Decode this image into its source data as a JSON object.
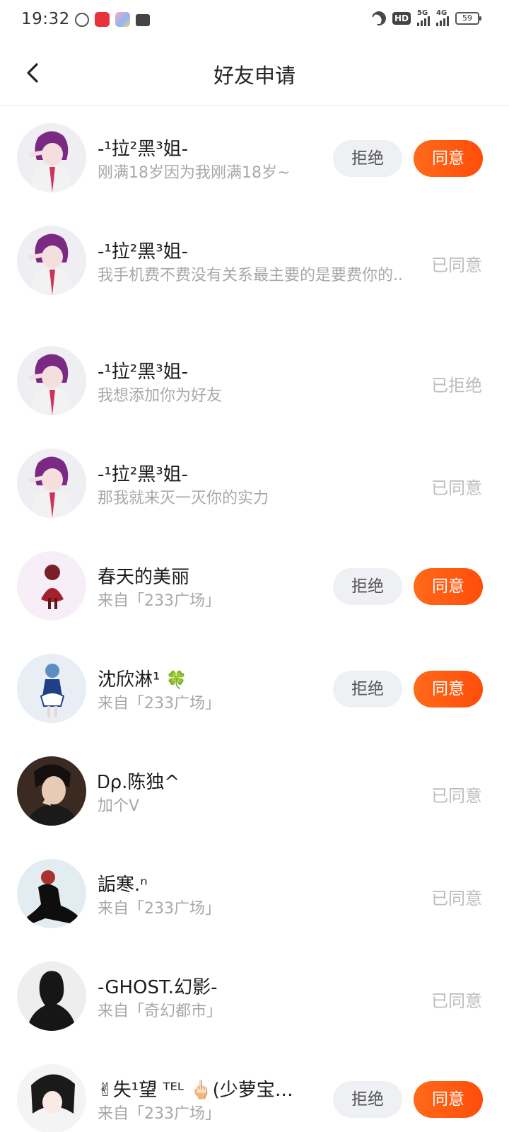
{
  "status_bar": {
    "time": "19:32",
    "hd_label": "HD",
    "net1": "5G",
    "net2": "4G",
    "battery": "59"
  },
  "header": {
    "title": "好友申请"
  },
  "buttons": {
    "reject": "拒绝",
    "accept": "同意"
  },
  "requests": [
    {
      "name": "-¹拉²黑³姐-",
      "message": "刚满18岁因为我刚满18岁~",
      "state": "pending",
      "avatar": "anime-girl-purple-hair-avatar"
    },
    {
      "name": "-¹拉²黑³姐-",
      "message": "我手机费不费没有关系最主要的是要费你的..",
      "state": "accepted",
      "status_text": "已同意",
      "avatar": "anime-girl-purple-hair-avatar"
    },
    {
      "name": "-¹拉²黑³姐-",
      "message": "我想添加你为好友",
      "state": "rejected",
      "status_text": "已拒绝",
      "avatar": "anime-girl-purple-hair-avatar"
    },
    {
      "name": "-¹拉²黑³姐-",
      "message": "那我就来灭一灭你的实力",
      "state": "accepted",
      "status_text": "已同意",
      "avatar": "anime-girl-purple-hair-avatar"
    },
    {
      "name": "春天的美丽",
      "message": "来自「233广场」",
      "state": "pending",
      "avatar": "red-dress-doll-avatar"
    },
    {
      "name": "沈欣淋¹",
      "name_emoji": "🍀",
      "message": "来自「233广场」",
      "state": "pending",
      "avatar": "blue-hair-maid-avatar"
    },
    {
      "name": "Ꭰρ.陈独^",
      "message": "加个V",
      "state": "accepted",
      "status_text": "已同意",
      "avatar": "boy-photo-avatar"
    },
    {
      "name": "詬寒.ⁿ",
      "message": "来自「233广场」",
      "state": "accepted",
      "status_text": "已同意",
      "avatar": "dark-figure-avatar"
    },
    {
      "name": "-GHOST.幻影-",
      "message": "来自「奇幻都市」",
      "state": "accepted",
      "status_text": "已同意",
      "avatar": "shadow-silhouette-avatar"
    },
    {
      "name": "✌失¹望 ᵀᴱᴸ 🖕🏻(少萝宝…",
      "message": "来自「233广场」",
      "state": "pending",
      "avatar": "manga-girl-avatar"
    }
  ]
}
